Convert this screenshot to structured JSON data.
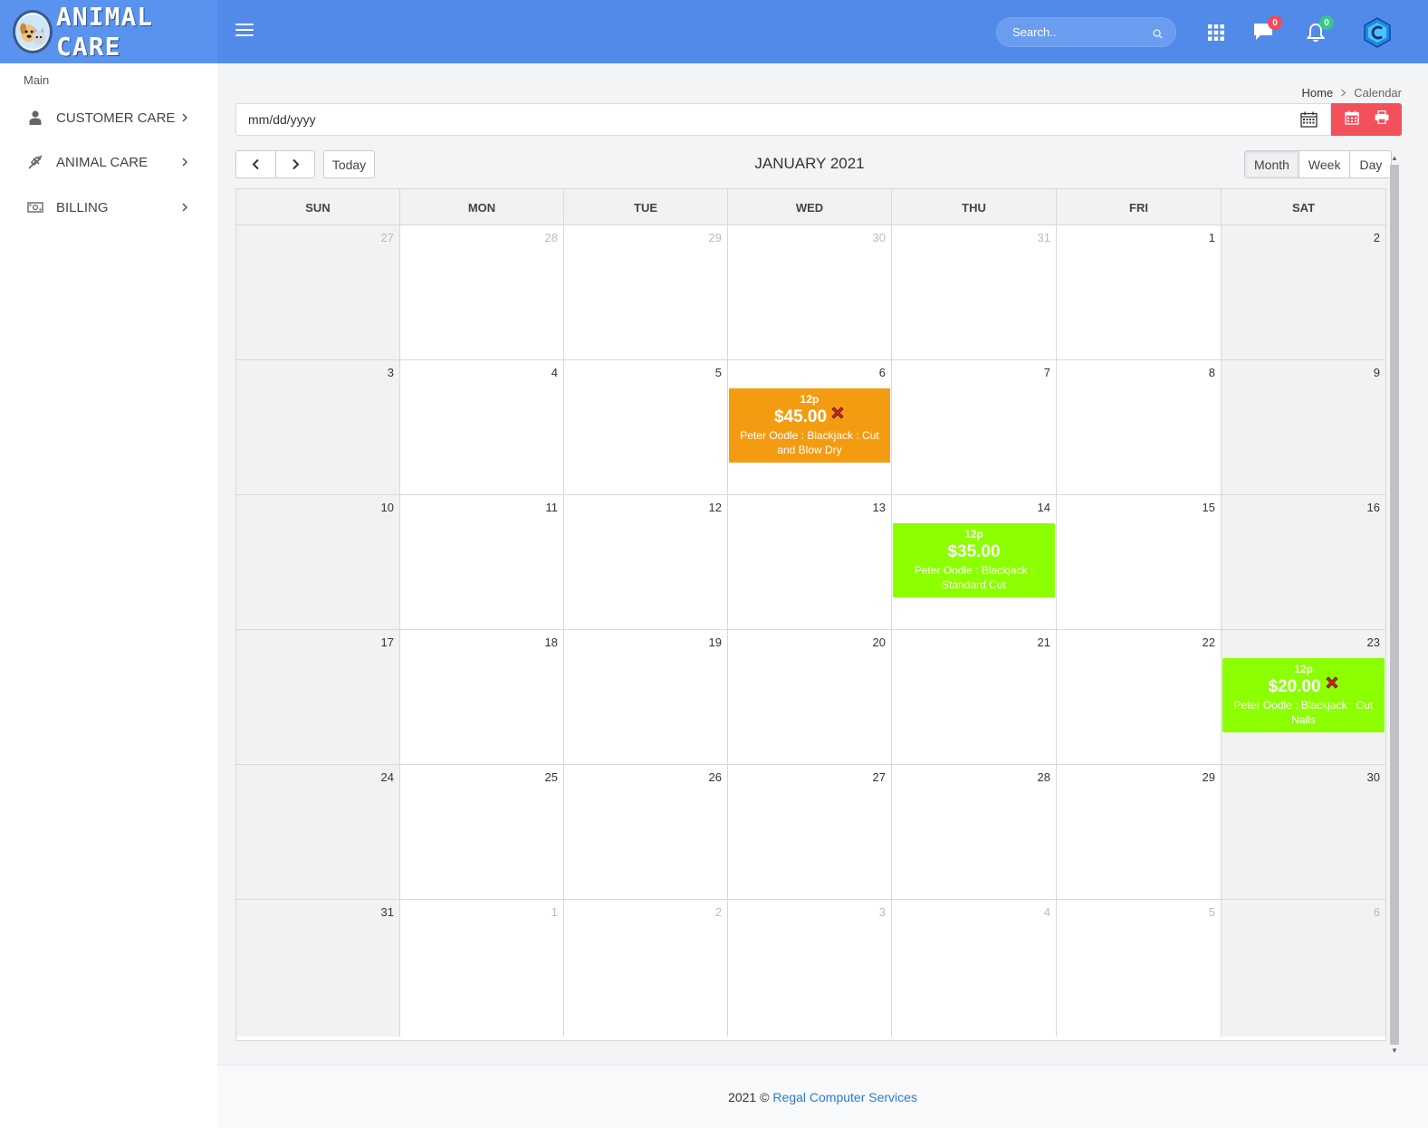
{
  "header": {
    "app_name": "ANIMAL CARE",
    "search_placeholder": "Search..",
    "messages_count": "0",
    "notifications_count": "0",
    "colors": {
      "bar": "#518ae8",
      "logo_bg": "#5a93ef",
      "badge_red": "#f44a5a",
      "badge_green": "#36c88a"
    }
  },
  "sidebar": {
    "section_label": "Main",
    "items": [
      {
        "label": "CUSTOMER CARE",
        "icon": "user-icon"
      },
      {
        "label": "ANIMAL CARE",
        "icon": "syringe-icon"
      },
      {
        "label": "BILLING",
        "icon": "money-icon"
      }
    ]
  },
  "breadcrumb": {
    "home": "Home",
    "current": "Calendar"
  },
  "date_filter": {
    "placeholder": "mm/dd/yyyy"
  },
  "calendar": {
    "title": "JANUARY 2021",
    "today_label": "Today",
    "views": [
      "Month",
      "Week",
      "Day"
    ],
    "active_view": "Month",
    "weekdays": [
      "SUN",
      "MON",
      "TUE",
      "WED",
      "THU",
      "FRI",
      "SAT"
    ],
    "weeks": [
      [
        {
          "d": "27",
          "other": true
        },
        {
          "d": "28",
          "other": true
        },
        {
          "d": "29",
          "other": true
        },
        {
          "d": "30",
          "other": true
        },
        {
          "d": "31",
          "other": true
        },
        {
          "d": "1"
        },
        {
          "d": "2"
        }
      ],
      [
        {
          "d": "3"
        },
        {
          "d": "4"
        },
        {
          "d": "5"
        },
        {
          "d": "6",
          "event": {
            "time": "12p",
            "amount": "$45.00",
            "cancelled": true,
            "desc": "Peter Oodle : Blackjack : Cut and Blow Dry",
            "color": "#f39c12"
          }
        },
        {
          "d": "7"
        },
        {
          "d": "8"
        },
        {
          "d": "9"
        }
      ],
      [
        {
          "d": "10"
        },
        {
          "d": "11"
        },
        {
          "d": "12"
        },
        {
          "d": "13"
        },
        {
          "d": "14",
          "event": {
            "time": "12p",
            "amount": "$35.00",
            "cancelled": false,
            "desc": "Peter Oodle : Blackjack : Standard Cut",
            "color": "#8cff00"
          }
        },
        {
          "d": "15"
        },
        {
          "d": "16"
        }
      ],
      [
        {
          "d": "17"
        },
        {
          "d": "18"
        },
        {
          "d": "19"
        },
        {
          "d": "20"
        },
        {
          "d": "21"
        },
        {
          "d": "22"
        },
        {
          "d": "23",
          "event": {
            "time": "12p",
            "amount": "$20.00",
            "cancelled": true,
            "desc": "Peter Oodle : Blackjack : Cut Nails",
            "color": "#8cff00"
          }
        }
      ],
      [
        {
          "d": "24"
        },
        {
          "d": "25"
        },
        {
          "d": "26"
        },
        {
          "d": "27"
        },
        {
          "d": "28"
        },
        {
          "d": "29"
        },
        {
          "d": "30"
        }
      ],
      [
        {
          "d": "31"
        },
        {
          "d": "1",
          "other": true
        },
        {
          "d": "2",
          "other": true
        },
        {
          "d": "3",
          "other": true
        },
        {
          "d": "4",
          "other": true
        },
        {
          "d": "5",
          "other": true
        },
        {
          "d": "6",
          "other": true
        }
      ]
    ]
  },
  "footer": {
    "year": "2021 ©",
    "company": "Regal Computer Services"
  }
}
